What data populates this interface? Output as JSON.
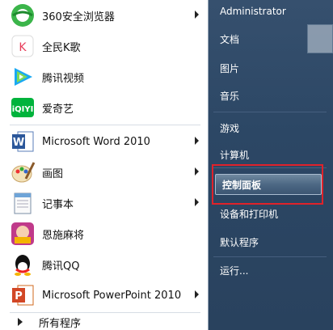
{
  "left_programs": [
    {
      "label": "360安全浏览器",
      "icon": "browser-360-icon",
      "has_submenu": true
    },
    {
      "label": "全民K歌",
      "icon": "karaoke-icon",
      "has_submenu": false
    },
    {
      "label": "腾讯视频",
      "icon": "tencent-video-icon",
      "has_submenu": false
    },
    {
      "label": "爱奇艺",
      "icon": "iqiyi-icon",
      "has_submenu": false
    },
    {
      "label": "Microsoft Word 2010",
      "icon": "word-icon",
      "has_submenu": true
    },
    {
      "label": "画图",
      "icon": "paint-icon",
      "has_submenu": true
    },
    {
      "label": "记事本",
      "icon": "notepad-icon",
      "has_submenu": true
    },
    {
      "label": "恩施麻将",
      "icon": "mahjong-icon",
      "has_submenu": false
    },
    {
      "label": "腾讯QQ",
      "icon": "qq-icon",
      "has_submenu": false
    },
    {
      "label": "Microsoft PowerPoint 2010",
      "icon": "powerpoint-icon",
      "has_submenu": true
    }
  ],
  "all_programs": "所有程序",
  "right_items": {
    "user": "Administrator",
    "documents": "文档",
    "pictures": "图片",
    "music": "音乐",
    "games": "游戏",
    "computer": "计算机",
    "control_panel": "控制面板",
    "devices_printers": "设备和打印机",
    "default_programs": "默认程序",
    "run": "运行..."
  },
  "colors": {
    "highlight_box": "#e0222a",
    "right_pane": "#2c4765"
  }
}
